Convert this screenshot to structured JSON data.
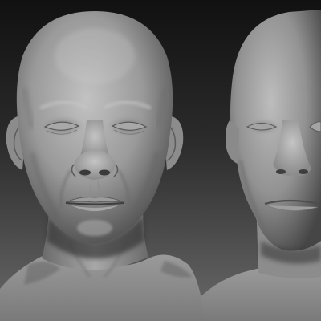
{
  "scene": {
    "subject": "sculpted-head-render",
    "views": [
      "front-view",
      "three-quarter-view"
    ],
    "colors": {
      "background_top": "#141414",
      "background_bottom": "#5a5a5a",
      "clay_light": "#b9b9b9",
      "clay_mid": "#8a8a8a",
      "clay_dark": "#4a4a4a",
      "shadow": "#2a2a2a"
    }
  }
}
